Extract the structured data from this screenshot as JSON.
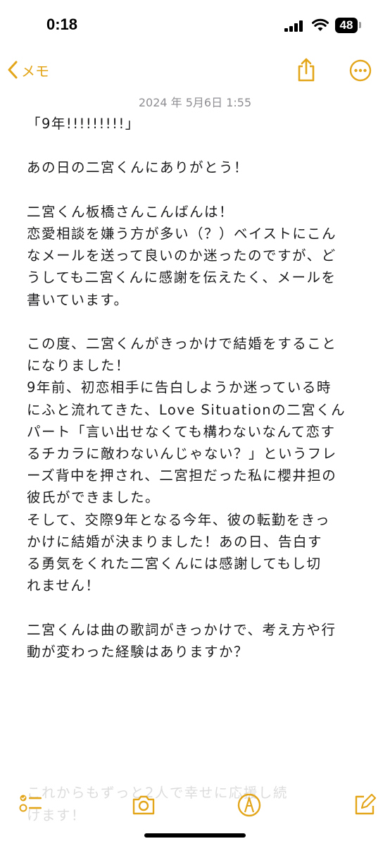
{
  "status_bar": {
    "time": "0:18",
    "battery": "48"
  },
  "nav": {
    "back_label": "メモ"
  },
  "note": {
    "date": "2024 年 5月6日 1:55",
    "lines": [
      "「9年!!!!!!!!!」",
      "",
      "あの日の二宮くんにありがとう！",
      "",
      "二宮くん板橋さんこんばんは！",
      "恋愛相談を嫌う方が多い（？）ベイストにこん",
      "なメールを送って良いのか迷ったのですが、ど",
      "うしても二宮くんに感謝を伝えたく、メールを",
      "書いています。",
      "",
      "この度、二宮くんがきっかけで結婚をすること",
      "になりました！",
      "9年前、初恋相手に告白しようか迷っている時",
      "にふと流れてきた、Love Situationの二宮くん",
      "パート「言い出せなくても構わないなんて恋す",
      "るチカラに敵わないんじゃない？」というフレ",
      "ーズ背中を押され、二宮担だった私に櫻井担の",
      "彼氏ができました。",
      "そして、交際9年となる今年、彼の転勤をきっ",
      "かけに結婚が決まりました！あの日、告白す",
      "る勇気をくれた二宮くんには感謝してもし切",
      "れません！",
      "",
      "二宮くんは曲の歌詞がきっかけで、考え方や行",
      "動が変わった経験はありますか？"
    ],
    "faded_lines": [
      "これからもずっと2人で幸せに応援し続",
      "けます！"
    ]
  },
  "toolbar": {
    "checklist_icon": "checklist-icon",
    "camera_icon": "camera-icon",
    "markup_icon": "markup-pen-icon",
    "compose_icon": "compose-icon"
  },
  "colors": {
    "accent": "#e3a51a",
    "text": "#1c1c1e",
    "date": "#8e8e93"
  }
}
